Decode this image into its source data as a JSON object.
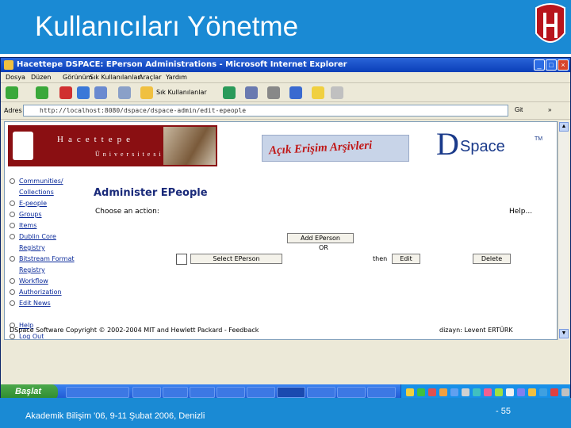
{
  "slide": {
    "title": "Kullanıcıları Yönetme",
    "footer": "Akademik Bilişim '06, 9-11 Şubat 2006, Denizli",
    "page_number": "- 55"
  },
  "window": {
    "title": "Hacettepe DSPACE: EPerson Administrations - Microsoft Internet Explorer",
    "menu": [
      "Dosya",
      "Düzen",
      "Görünüm",
      "Sık Kullanılanlar",
      "Araçlar",
      "Yardım"
    ],
    "toolbar": {
      "favorites_label": "Sık Kullanılanlar"
    },
    "address": {
      "label": "Adres",
      "url": "http://localhost:8080/dspace/dspace-admin/edit-epeople",
      "go_label": "Git",
      "links_label": "»"
    }
  },
  "page": {
    "banner": {
      "name": "Hacettepe",
      "sub": "Üniversitesi"
    },
    "open_access_label": "Açık Erişim Arşivleri",
    "dspace": {
      "d": "D",
      "space": "Space",
      "tm": "TM"
    },
    "nav": [
      "Communities/",
      "Collections",
      "E-people",
      "Groups",
      "Items",
      "Dublin Core",
      "Registry",
      "Bitstream Format",
      "Registry",
      "Workflow",
      "Authorization",
      "Edit News",
      "",
      "Help",
      "Log Out"
    ],
    "heading": "Administer EPeople",
    "choose_label": "Choose an action:",
    "help_label": "Help...",
    "add_button": "Add EPerson",
    "or_label": "OR",
    "select_button": "Select EPerson",
    "then_label": "then",
    "edit_button": "Edit",
    "delete_button": "Delete",
    "footer": "DSpace Software Copyright © 2002-2004 MIT and Hewlett Packard - Feedback",
    "credit": "dizayn: Levent ERTÜRK"
  },
  "taskbar": {
    "start_label": "Başlat"
  }
}
